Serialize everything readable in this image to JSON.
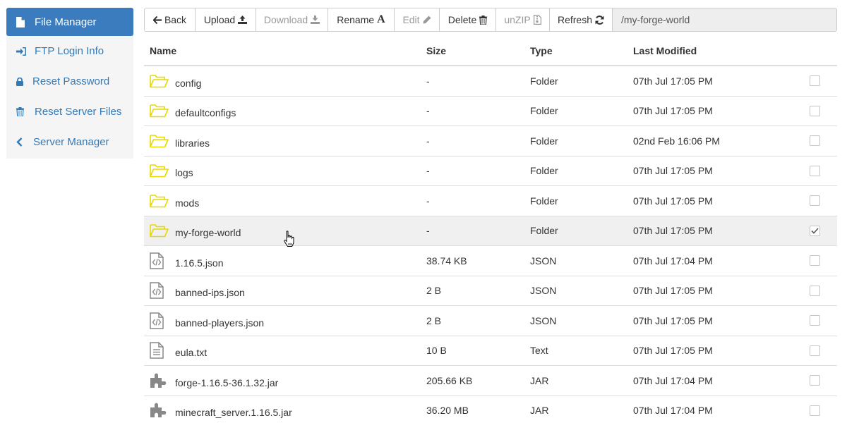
{
  "sidebar": {
    "items": [
      {
        "label": "File Manager",
        "icon": "file-icon",
        "active": true
      },
      {
        "label": "FTP Login Info",
        "icon": "sign-in-icon",
        "active": false
      },
      {
        "label": "Reset Password",
        "icon": "lock-icon",
        "active": false
      },
      {
        "label": "Reset Server Files",
        "icon": "trash-icon",
        "active": false
      },
      {
        "label": "Server Manager",
        "icon": "chevron-left-icon",
        "active": false
      }
    ]
  },
  "toolbar": {
    "back_label": "Back",
    "upload_label": "Upload",
    "download_label": "Download",
    "rename_label": "Rename",
    "edit_label": "Edit",
    "delete_label": "Delete",
    "unzip_label": "unZIP",
    "refresh_label": "Refresh",
    "path": "/my-forge-world"
  },
  "table": {
    "headers": {
      "name": "Name",
      "size": "Size",
      "type": "Type",
      "modified": "Last Modified"
    },
    "rows": [
      {
        "name": "config",
        "size": "-",
        "type": "Folder",
        "modified": "07th Jul 17:05 PM",
        "icon": "folder-icon",
        "checked": false
      },
      {
        "name": "defaultconfigs",
        "size": "-",
        "type": "Folder",
        "modified": "07th Jul 17:05 PM",
        "icon": "folder-icon",
        "checked": false
      },
      {
        "name": "libraries",
        "size": "-",
        "type": "Folder",
        "modified": "02nd Feb 16:06 PM",
        "icon": "folder-icon",
        "checked": false
      },
      {
        "name": "logs",
        "size": "-",
        "type": "Folder",
        "modified": "07th Jul 17:05 PM",
        "icon": "folder-icon",
        "checked": false
      },
      {
        "name": "mods",
        "size": "-",
        "type": "Folder",
        "modified": "07th Jul 17:05 PM",
        "icon": "folder-icon",
        "checked": false
      },
      {
        "name": "my-forge-world",
        "size": "-",
        "type": "Folder",
        "modified": "07th Jul 17:05 PM",
        "icon": "folder-icon",
        "checked": true
      },
      {
        "name": "1.16.5.json",
        "size": "38.74 KB",
        "type": "JSON",
        "modified": "07th Jul 17:04 PM",
        "icon": "code-file-icon",
        "checked": false
      },
      {
        "name": "banned-ips.json",
        "size": "2 B",
        "type": "JSON",
        "modified": "07th Jul 17:05 PM",
        "icon": "code-file-icon",
        "checked": false
      },
      {
        "name": "banned-players.json",
        "size": "2 B",
        "type": "JSON",
        "modified": "07th Jul 17:05 PM",
        "icon": "code-file-icon",
        "checked": false
      },
      {
        "name": "eula.txt",
        "size": "10 B",
        "type": "Text",
        "modified": "07th Jul 17:05 PM",
        "icon": "text-file-icon",
        "checked": false
      },
      {
        "name": "forge-1.16.5-36.1.32.jar",
        "size": "205.66 KB",
        "type": "JAR",
        "modified": "07th Jul 17:04 PM",
        "icon": "puzzle-icon",
        "checked": false
      },
      {
        "name": "minecraft_server.1.16.5.jar",
        "size": "36.20 MB",
        "type": "JAR",
        "modified": "07th Jul 17:04 PM",
        "icon": "puzzle-icon",
        "checked": false
      }
    ]
  },
  "colors": {
    "accent": "#3a7cbd",
    "link": "#337ab7",
    "folder": "#e8d800",
    "file_icon": "#888888"
  }
}
